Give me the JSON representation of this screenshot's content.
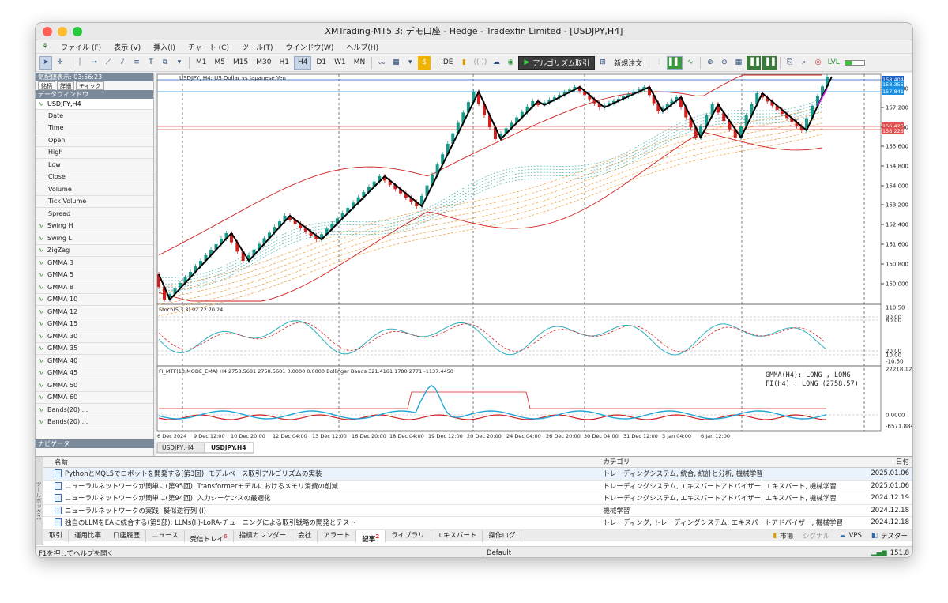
{
  "window": {
    "title": "XMTrading-MT5 3: デモ口座 - Hedge - Tradexfin Limited - [USDJPY,H4]"
  },
  "menu": [
    "ファイル (F)",
    "表示 (V)",
    "挿入(I)",
    "チャート (C)",
    "ツール(T)",
    "ウインドウ(W)",
    "ヘルプ(H)"
  ],
  "toolbar": {
    "timeframes": [
      "M1",
      "M5",
      "M15",
      "M30",
      "H1",
      "H4",
      "D1",
      "W1",
      "MN"
    ],
    "active_tf": "H4",
    "ide": "IDE",
    "algo_label": "アルゴリズム取引",
    "new_order": "新規注文"
  },
  "side": {
    "market_header": "気配値表示: 03:56:23",
    "market_tabs": [
      "銘柄",
      "詳細",
      "ティック"
    ],
    "data_header": "データウィンドウ",
    "symbol": "USDJPY,H4",
    "rows": [
      "Date",
      "Time",
      "Open",
      "High",
      "Low",
      "Close",
      "Volume",
      "Tick Volume",
      "Spread"
    ],
    "indicators": [
      "Swing H",
      "Swing L",
      "ZigZag",
      "GMMA 3",
      "GMMA 5",
      "GMMA 8",
      "GMMA 10",
      "GMMA 12",
      "GMMA 15",
      "GMMA 30",
      "GMMA 35",
      "GMMA 40",
      "GMMA 45",
      "GMMA 50",
      "GMMA 60",
      "Bands(20) ...",
      "Bands(20) ..."
    ],
    "nav_header": "ナビゲータ"
  },
  "chart": {
    "header": "USDJPY, H4: US Dollar vs Japanese Yen",
    "price_labels": [
      "158.000",
      "157.200",
      "156.400",
      "155.600",
      "154.800",
      "154.000",
      "153.200",
      "152.400",
      "151.600",
      "150.800",
      "150.000"
    ],
    "price_tags": {
      "blue_top": "158.404",
      "blue_mid": "158.355",
      "blue2": "157.841",
      "red_top": "156.425",
      "red2": "156.226"
    },
    "stoch": {
      "title": "Stoch(5,3,3) 92.72 70.24",
      "levels": [
        "110.50",
        "90.00",
        "80.00",
        "20.00",
        "10.00",
        "-10.50"
      ]
    },
    "fi": {
      "title": "FI_MTF(13,MODE_EMA) H4 2758.5681 2758.5681 0.0000 0.0000 Bollinger Bands 321.4161 1780.2771 -1137.4450",
      "levels": [
        "22218.1246",
        "0.0000",
        "-6571.8848"
      ],
      "note_1": "GMMA(H4): LONG , LONG",
      "note_2": "FI(H4)  : LONG (2758.57)"
    },
    "dates": [
      "6 Dec 2024",
      "9 Dec 12:00",
      "10 Dec 20:00",
      "12 Dec 04:00",
      "13 Dec 12:00",
      "16 Dec 20:00",
      "18 Dec 04:00",
      "19 Dec 12:00",
      "20 Dec 20:00",
      "24 Dec 04:00",
      "26 Dec 20:00",
      "30 Dec 04:00",
      "31 Dec 12:00",
      "3 Jan 04:00",
      "6 Jan 12:00"
    ],
    "tabs": [
      "USDJPY,H4",
      "USDJPY,H4"
    ]
  },
  "toolbox": {
    "side_label": "ツールボックス",
    "col_name": "名前",
    "col_cat": "カテゴリ",
    "col_date": "日付",
    "rows": [
      {
        "name": "PythonとMQL5でロボットを開発する(第3回): モデルベース取引アルゴリズムの実装",
        "cat": "トレーディングシステム, 統合, 統計と分析, 機械学習",
        "date": "2025.01.06"
      },
      {
        "name": "ニューラルネットワークが簡単に(第95回): Transformerモデルにおけるメモリ消費の削減",
        "cat": "トレーディングシステム, エキスパートアドバイザー, エキスパート, 機械学習",
        "date": "2025.01.06"
      },
      {
        "name": "ニューラルネットワークが簡単に(第94回): 入力シーケンスの最適化",
        "cat": "トレーディングシステム, エキスパートアドバイザー, エキスパート, 機械学習",
        "date": "2024.12.19"
      },
      {
        "name": "ニューラルネットワークの実践: 擬似逆行列 (I)",
        "cat": "機械学習",
        "date": "2024.12.18"
      },
      {
        "name": "独自のLLMをEAに統合する(第5部): LLMs(II)-LoRA-チューニングによる取引戦略の開発とテスト",
        "cat": "トレーディング, トレーディングシステム, エキスパートアドバイザー, 機械学習",
        "date": "2024.12.18"
      }
    ],
    "tabs": [
      "取引",
      "運用比率",
      "口座履歴",
      "ニュース",
      "受信トレイ",
      "指標カレンダー",
      "会社",
      "アラート",
      "記事",
      "ライブラリ",
      "エキスパート",
      "操作ログ"
    ],
    "active_tab": "記事",
    "inbox_badge": "6",
    "article_badge": "2",
    "right_tabs": [
      "市場",
      "シグナル",
      "VPS",
      "テスター"
    ]
  },
  "status": {
    "help": "F1を押してヘルプを開く",
    "profile": "Default",
    "speed": "151.8"
  },
  "colors": {
    "bull": "#1a9a8a",
    "bear": "#d02020",
    "zigzag": "#000000",
    "bands": "#d02020",
    "stoch_main": "#2ab0c0",
    "fi": "#1fa6d8"
  }
}
